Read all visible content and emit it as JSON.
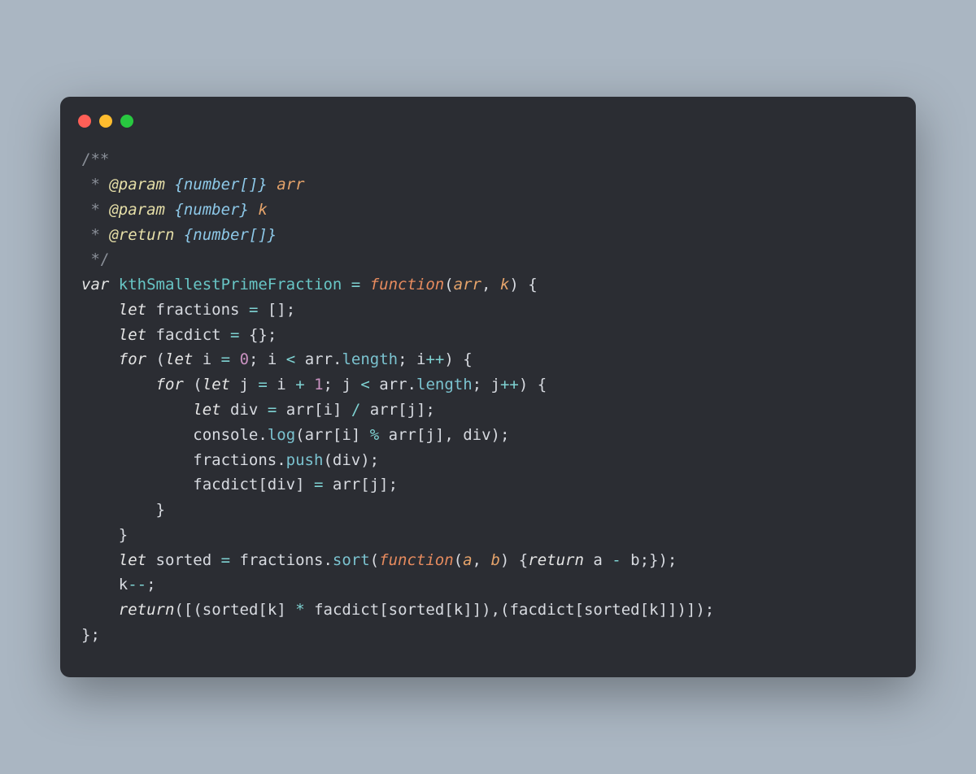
{
  "window": {
    "traffic_lights": [
      "red",
      "yellow",
      "green"
    ]
  },
  "colors": {
    "bg_page": "#aab6c2",
    "bg_window": "#2b2d33",
    "red": "#ff5f57",
    "yellow": "#febc2e",
    "green": "#28c840"
  },
  "code": {
    "lines": [
      [
        [
          "c-comment",
          "/**"
        ]
      ],
      [
        [
          "c-comment",
          " * "
        ],
        [
          "c-docattr",
          "@param"
        ],
        [
          "c-comment",
          " "
        ],
        [
          "c-doctype",
          "{number[]}"
        ],
        [
          "c-comment",
          " "
        ],
        [
          "c-docparam",
          "arr"
        ]
      ],
      [
        [
          "c-comment",
          " * "
        ],
        [
          "c-docattr",
          "@param"
        ],
        [
          "c-comment",
          " "
        ],
        [
          "c-doctype",
          "{number}"
        ],
        [
          "c-comment",
          " "
        ],
        [
          "c-docparam",
          "k"
        ]
      ],
      [
        [
          "c-comment",
          " * "
        ],
        [
          "c-docattr",
          "@return"
        ],
        [
          "c-comment",
          " "
        ],
        [
          "c-doctype",
          "{number[]}"
        ]
      ],
      [
        [
          "c-comment",
          " */"
        ]
      ],
      [
        [
          "c-kw",
          "var"
        ],
        [
          "c-ident",
          " "
        ],
        [
          "c-funcname",
          "kthSmallestPrimeFraction"
        ],
        [
          "c-ident",
          " "
        ],
        [
          "c-op",
          "="
        ],
        [
          "c-ident",
          " "
        ],
        [
          "c-funckw",
          "function"
        ],
        [
          "c-paren",
          "("
        ],
        [
          "c-param",
          "arr"
        ],
        [
          "c-punct",
          ", "
        ],
        [
          "c-param",
          "k"
        ],
        [
          "c-paren",
          ")"
        ],
        [
          "c-ident",
          " "
        ],
        [
          "c-brace",
          "{"
        ]
      ],
      [
        [
          "c-ident",
          "    "
        ],
        [
          "c-kwlet",
          "let"
        ],
        [
          "c-ident",
          " fractions "
        ],
        [
          "c-op",
          "="
        ],
        [
          "c-ident",
          " "
        ],
        [
          "c-brack",
          "[]"
        ],
        [
          "c-punct",
          ";"
        ]
      ],
      [
        [
          "c-ident",
          "    "
        ],
        [
          "c-kwlet",
          "let"
        ],
        [
          "c-ident",
          " facdict "
        ],
        [
          "c-op",
          "="
        ],
        [
          "c-ident",
          " "
        ],
        [
          "c-brace",
          "{}"
        ],
        [
          "c-punct",
          ";"
        ]
      ],
      [
        [
          "c-ident",
          "    "
        ],
        [
          "c-kw",
          "for"
        ],
        [
          "c-ident",
          " "
        ],
        [
          "c-paren",
          "("
        ],
        [
          "c-kwlet",
          "let"
        ],
        [
          "c-ident",
          " i "
        ],
        [
          "c-op",
          "="
        ],
        [
          "c-ident",
          " "
        ],
        [
          "c-num",
          "0"
        ],
        [
          "c-punct",
          "; "
        ],
        [
          "c-ident",
          "i "
        ],
        [
          "c-op",
          "<"
        ],
        [
          "c-ident",
          " arr"
        ],
        [
          "c-punct",
          "."
        ],
        [
          "c-prop",
          "length"
        ],
        [
          "c-punct",
          "; "
        ],
        [
          "c-ident",
          "i"
        ],
        [
          "c-op",
          "++"
        ],
        [
          "c-paren",
          ")"
        ],
        [
          "c-ident",
          " "
        ],
        [
          "c-brace",
          "{"
        ]
      ],
      [
        [
          "c-ident",
          "        "
        ],
        [
          "c-kw",
          "for"
        ],
        [
          "c-ident",
          " "
        ],
        [
          "c-paren",
          "("
        ],
        [
          "c-kwlet",
          "let"
        ],
        [
          "c-ident",
          " j "
        ],
        [
          "c-op",
          "="
        ],
        [
          "c-ident",
          " i "
        ],
        [
          "c-op",
          "+"
        ],
        [
          "c-ident",
          " "
        ],
        [
          "c-num",
          "1"
        ],
        [
          "c-punct",
          "; "
        ],
        [
          "c-ident",
          "j "
        ],
        [
          "c-op",
          "<"
        ],
        [
          "c-ident",
          " arr"
        ],
        [
          "c-punct",
          "."
        ],
        [
          "c-prop",
          "length"
        ],
        [
          "c-punct",
          "; "
        ],
        [
          "c-ident",
          "j"
        ],
        [
          "c-op",
          "++"
        ],
        [
          "c-paren",
          ")"
        ],
        [
          "c-ident",
          " "
        ],
        [
          "c-brace",
          "{"
        ]
      ],
      [
        [
          "c-ident",
          "            "
        ],
        [
          "c-kwlet",
          "let"
        ],
        [
          "c-ident",
          " div "
        ],
        [
          "c-op",
          "="
        ],
        [
          "c-ident",
          " arr"
        ],
        [
          "c-brack",
          "["
        ],
        [
          "c-ident",
          "i"
        ],
        [
          "c-brack",
          "]"
        ],
        [
          "c-ident",
          " "
        ],
        [
          "c-op",
          "/"
        ],
        [
          "c-ident",
          " arr"
        ],
        [
          "c-brack",
          "["
        ],
        [
          "c-ident",
          "j"
        ],
        [
          "c-brack",
          "]"
        ],
        [
          "c-punct",
          ";"
        ]
      ],
      [
        [
          "c-ident",
          "            "
        ],
        [
          "c-obj",
          "console"
        ],
        [
          "c-punct",
          "."
        ],
        [
          "c-call",
          "log"
        ],
        [
          "c-paren",
          "("
        ],
        [
          "c-ident",
          "arr"
        ],
        [
          "c-brack",
          "["
        ],
        [
          "c-ident",
          "i"
        ],
        [
          "c-brack",
          "]"
        ],
        [
          "c-ident",
          " "
        ],
        [
          "c-op",
          "%"
        ],
        [
          "c-ident",
          " arr"
        ],
        [
          "c-brack",
          "["
        ],
        [
          "c-ident",
          "j"
        ],
        [
          "c-brack",
          "]"
        ],
        [
          "c-punct",
          ", "
        ],
        [
          "c-ident",
          "div"
        ],
        [
          "c-paren",
          ")"
        ],
        [
          "c-punct",
          ";"
        ]
      ],
      [
        [
          "c-ident",
          "            fractions"
        ],
        [
          "c-punct",
          "."
        ],
        [
          "c-call",
          "push"
        ],
        [
          "c-paren",
          "("
        ],
        [
          "c-ident",
          "div"
        ],
        [
          "c-paren",
          ")"
        ],
        [
          "c-punct",
          ";"
        ]
      ],
      [
        [
          "c-ident",
          "            facdict"
        ],
        [
          "c-brack",
          "["
        ],
        [
          "c-ident",
          "div"
        ],
        [
          "c-brack",
          "]"
        ],
        [
          "c-ident",
          " "
        ],
        [
          "c-op",
          "="
        ],
        [
          "c-ident",
          " arr"
        ],
        [
          "c-brack",
          "["
        ],
        [
          "c-ident",
          "j"
        ],
        [
          "c-brack",
          "]"
        ],
        [
          "c-punct",
          ";"
        ]
      ],
      [
        [
          "c-ident",
          "        "
        ],
        [
          "c-brace",
          "}"
        ]
      ],
      [
        [
          "c-ident",
          "    "
        ],
        [
          "c-brace",
          "}"
        ]
      ],
      [
        [
          "c-ident",
          "    "
        ],
        [
          "c-kwlet",
          "let"
        ],
        [
          "c-ident",
          " sorted "
        ],
        [
          "c-op",
          "="
        ],
        [
          "c-ident",
          " fractions"
        ],
        [
          "c-punct",
          "."
        ],
        [
          "c-call",
          "sort"
        ],
        [
          "c-paren",
          "("
        ],
        [
          "c-funckw",
          "function"
        ],
        [
          "c-paren",
          "("
        ],
        [
          "c-param",
          "a"
        ],
        [
          "c-punct",
          ", "
        ],
        [
          "c-param",
          "b"
        ],
        [
          "c-paren",
          ")"
        ],
        [
          "c-ident",
          " "
        ],
        [
          "c-brace",
          "{"
        ],
        [
          "c-kw",
          "return"
        ],
        [
          "c-ident",
          " a "
        ],
        [
          "c-op",
          "-"
        ],
        [
          "c-ident",
          " b"
        ],
        [
          "c-punct",
          ";"
        ],
        [
          "c-brace",
          "}"
        ],
        [
          "c-paren",
          ")"
        ],
        [
          "c-punct",
          ";"
        ]
      ],
      [
        [
          "c-ident",
          "    k"
        ],
        [
          "c-op",
          "--"
        ],
        [
          "c-punct",
          ";"
        ]
      ],
      [
        [
          "c-ident",
          "    "
        ],
        [
          "c-kw",
          "return"
        ],
        [
          "c-paren",
          "("
        ],
        [
          "c-brack",
          "["
        ],
        [
          "c-paren",
          "("
        ],
        [
          "c-ident",
          "sorted"
        ],
        [
          "c-brack",
          "["
        ],
        [
          "c-ident",
          "k"
        ],
        [
          "c-brack",
          "]"
        ],
        [
          "c-ident",
          " "
        ],
        [
          "c-op",
          "*"
        ],
        [
          "c-ident",
          " facdict"
        ],
        [
          "c-brack",
          "["
        ],
        [
          "c-ident",
          "sorted"
        ],
        [
          "c-brack",
          "["
        ],
        [
          "c-ident",
          "k"
        ],
        [
          "c-brack",
          "]"
        ],
        [
          "c-brack",
          "]"
        ],
        [
          "c-paren",
          ")"
        ],
        [
          "c-punct",
          ","
        ],
        [
          "c-paren",
          "("
        ],
        [
          "c-ident",
          "facdict"
        ],
        [
          "c-brack",
          "["
        ],
        [
          "c-ident",
          "sorted"
        ],
        [
          "c-brack",
          "["
        ],
        [
          "c-ident",
          "k"
        ],
        [
          "c-brack",
          "]"
        ],
        [
          "c-brack",
          "]"
        ],
        [
          "c-paren",
          ")"
        ],
        [
          "c-brack",
          "]"
        ],
        [
          "c-paren",
          ")"
        ],
        [
          "c-punct",
          ";"
        ]
      ],
      [
        [
          "c-brace",
          "}"
        ],
        [
          "c-punct",
          ";"
        ]
      ]
    ]
  }
}
